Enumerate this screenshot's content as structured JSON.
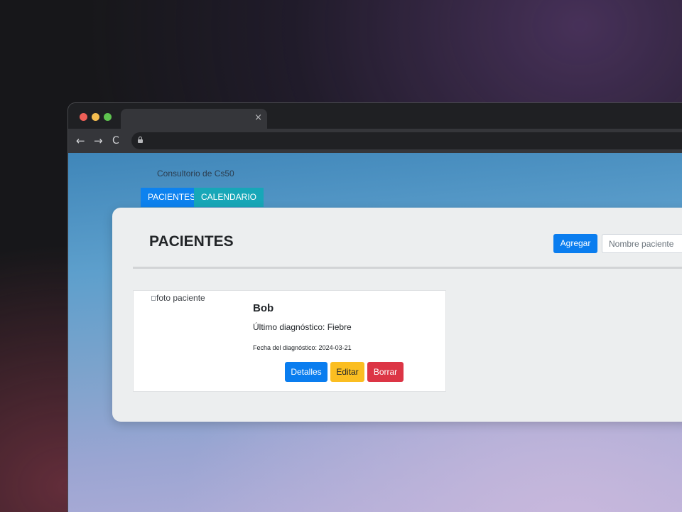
{
  "browser": {
    "tab_title": "",
    "tab_close": "×",
    "address_url": "",
    "nav": {
      "back": "←",
      "forward": "→",
      "reload": "C"
    }
  },
  "site": {
    "brand": "Consultorio de Cs50",
    "nav_tabs": [
      {
        "label": "PACIENTES"
      },
      {
        "label": "CALENDARIO"
      }
    ]
  },
  "main": {
    "title": "PACIENTES",
    "add_button": "Agregar",
    "search": {
      "placeholder": "Nombre paciente",
      "value": ""
    }
  },
  "patients": [
    {
      "photo_alt": "foto paciente",
      "name": "Bob",
      "diagnosis": "Último diagnóstico: Fiebre",
      "date": "Fecha del diagnóstico: 2024-03-21",
      "buttons": {
        "details": "Detalles",
        "edit": "Editar",
        "delete": "Borrar"
      }
    }
  ],
  "colors": {
    "primary": "#0a7def",
    "info": "#17a7b8",
    "warning": "#fbbe21",
    "danger": "#dc3545"
  }
}
